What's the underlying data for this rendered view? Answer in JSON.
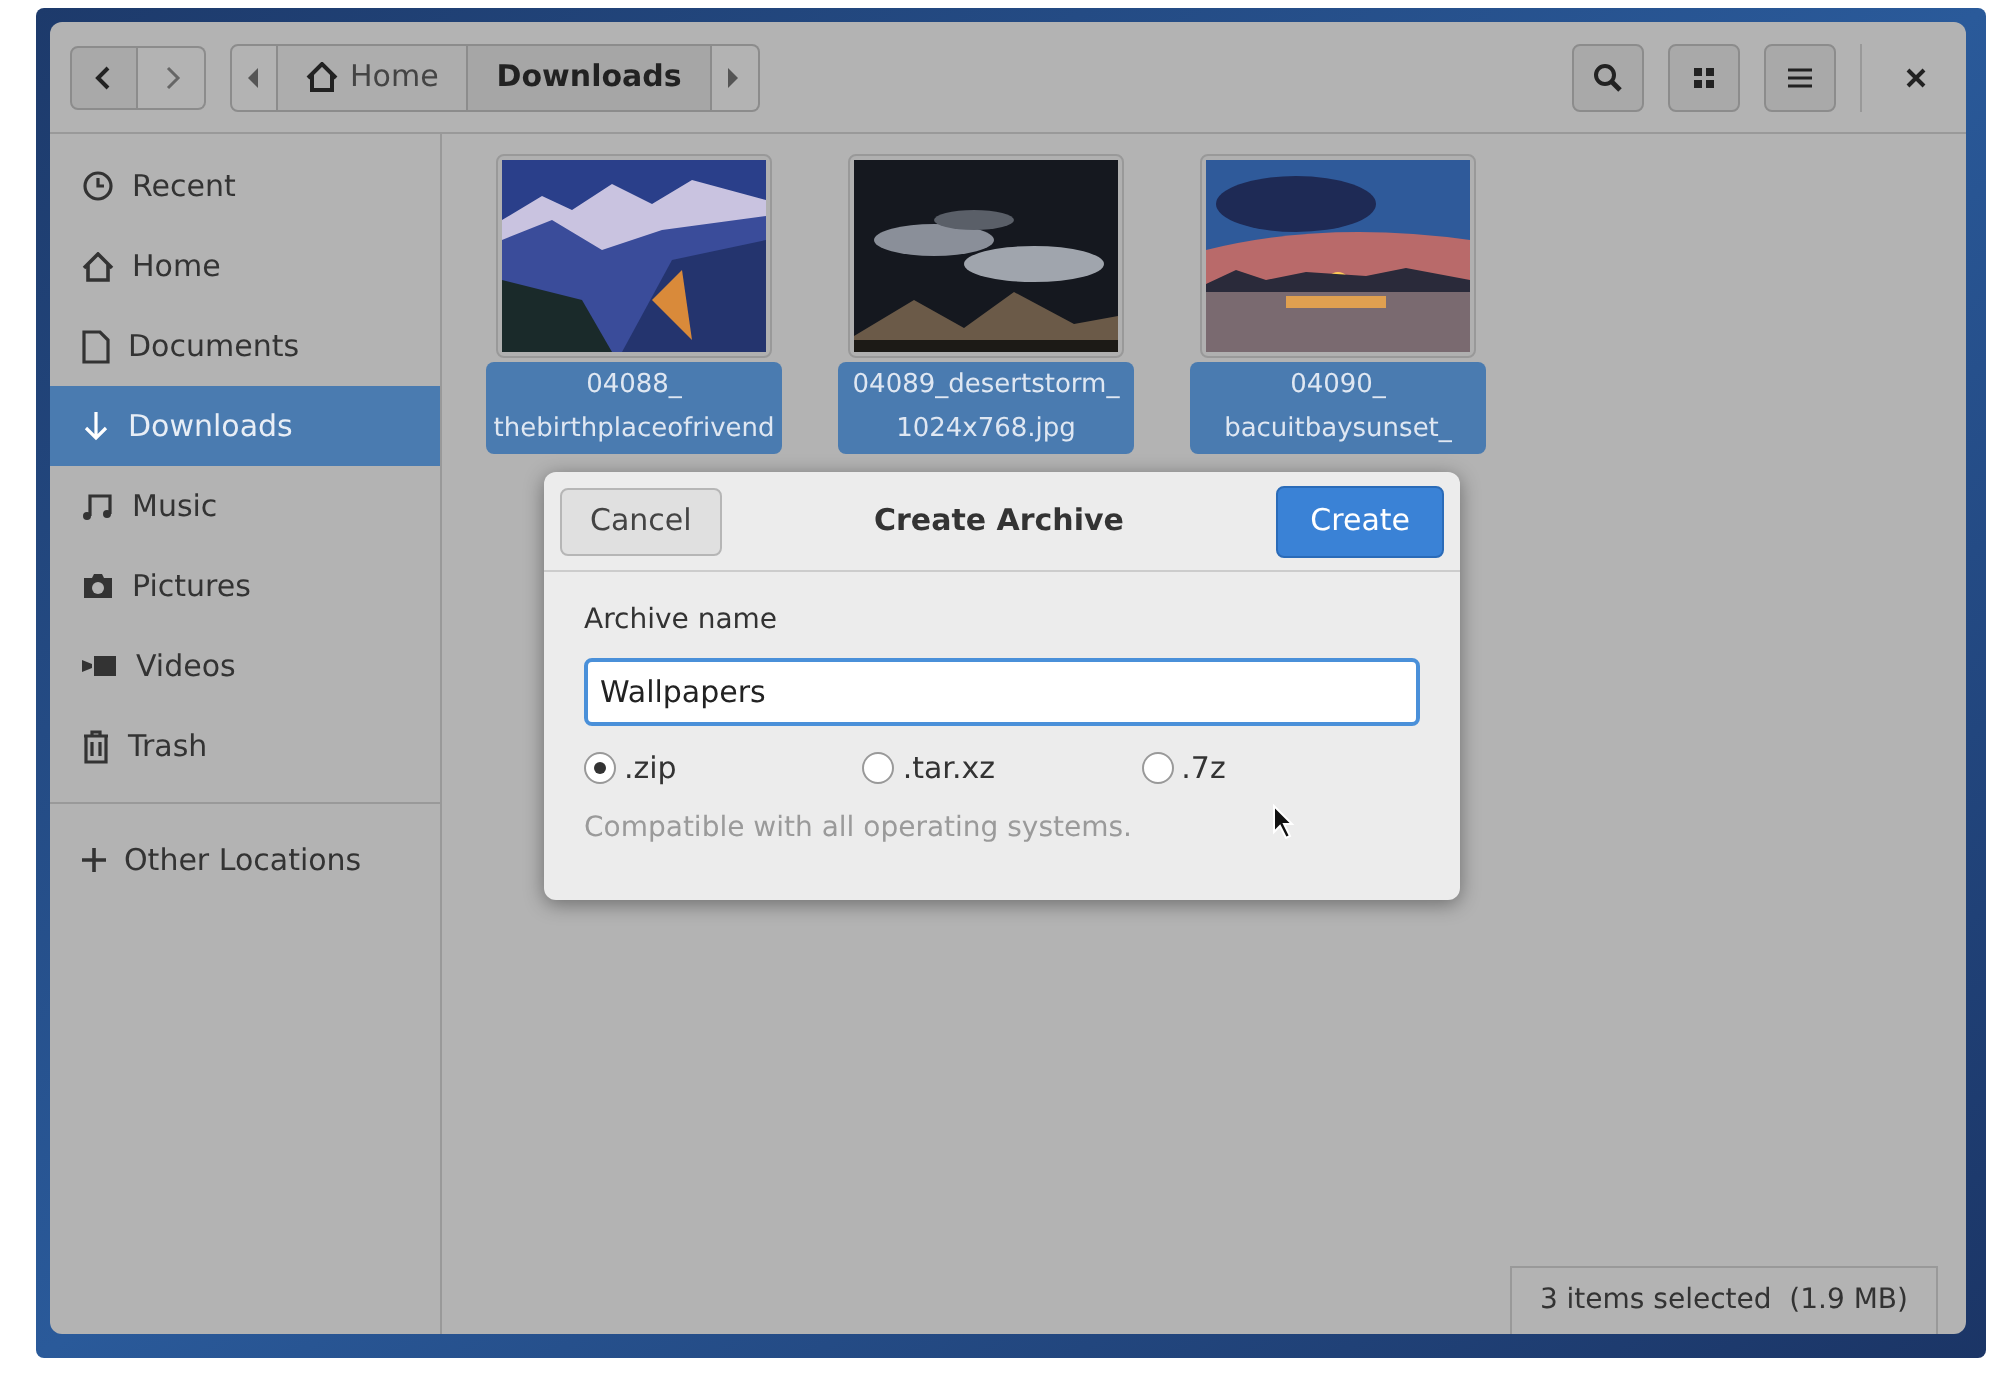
{
  "header": {
    "breadcrumbs": [
      {
        "label": "Home",
        "selected": false
      },
      {
        "label": "Downloads",
        "selected": true
      }
    ]
  },
  "sidebar": {
    "items": [
      {
        "label": "Recent",
        "selected": false
      },
      {
        "label": "Home",
        "selected": false
      },
      {
        "label": "Documents",
        "selected": false
      },
      {
        "label": "Downloads",
        "selected": true
      },
      {
        "label": "Music",
        "selected": false
      },
      {
        "label": "Pictures",
        "selected": false
      },
      {
        "label": "Videos",
        "selected": false
      },
      {
        "label": "Trash",
        "selected": false
      },
      {
        "label": "Other Locations",
        "selected": false
      }
    ]
  },
  "files": [
    {
      "lines": [
        "04088_",
        "thebirthplaceofrivend"
      ],
      "selected": true
    },
    {
      "lines": [
        "04089_desertstorm_",
        "1024x768.jpg"
      ],
      "selected": true
    },
    {
      "lines": [
        "04090_",
        "bacuitbaysunset_"
      ],
      "selected": true
    }
  ],
  "status_bar": "3 items selected  (1.9 MB)",
  "dialog": {
    "title": "Create Archive",
    "cancel": "Cancel",
    "confirm": "Create",
    "field_label": "Archive name",
    "value": "Wallpapers",
    "formats": [
      {
        "label": ".zip",
        "selected": true
      },
      {
        "label": ".tar.xz",
        "selected": false
      },
      {
        "label": ".7z",
        "selected": false
      }
    ],
    "hint": "Compatible with all operating systems."
  }
}
